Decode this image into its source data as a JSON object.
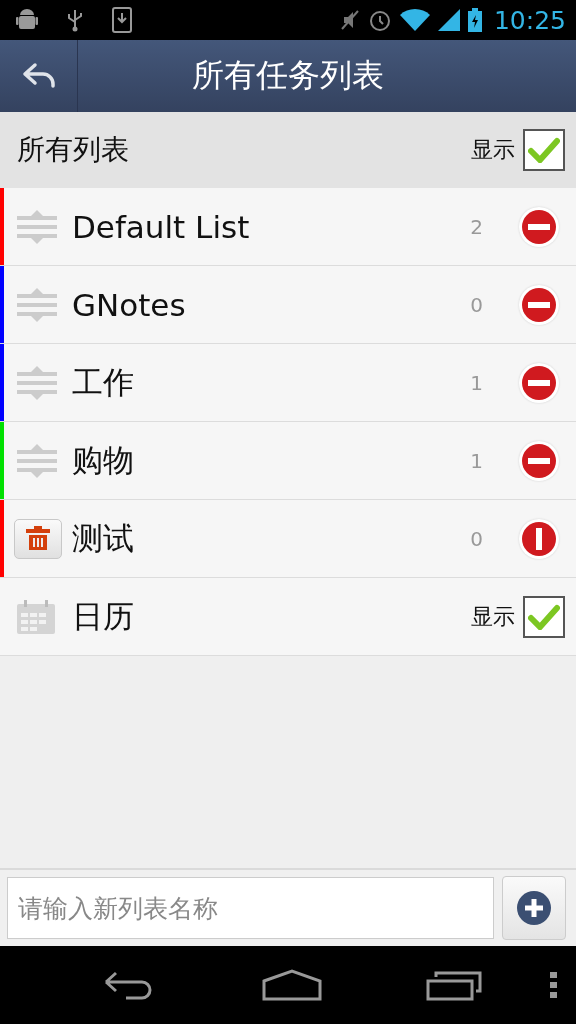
{
  "status_bar": {
    "time": "10:25"
  },
  "header": {
    "title": "所有任务列表"
  },
  "all_lists": {
    "label": "所有列表",
    "toggle_label": "显示",
    "checked": true
  },
  "lists": [
    {
      "kind": "list",
      "name": "Default List",
      "count": "2",
      "color": "#ff0000",
      "delete_armed": false
    },
    {
      "kind": "list",
      "name": "GNotes",
      "count": "0",
      "color": "#0000ff",
      "delete_armed": false
    },
    {
      "kind": "list",
      "name": "工作",
      "count": "1",
      "color": "#0000ff",
      "delete_armed": false
    },
    {
      "kind": "list",
      "name": "购物",
      "count": "1",
      "color": "#00e000",
      "delete_armed": false
    },
    {
      "kind": "list",
      "name": "测试",
      "count": "0",
      "color": "#ff0000",
      "delete_armed": true
    },
    {
      "kind": "toggle",
      "name": "日历",
      "toggle_label": "显示",
      "checked": true
    }
  ],
  "new_list": {
    "placeholder": "请输入新列表名称"
  }
}
